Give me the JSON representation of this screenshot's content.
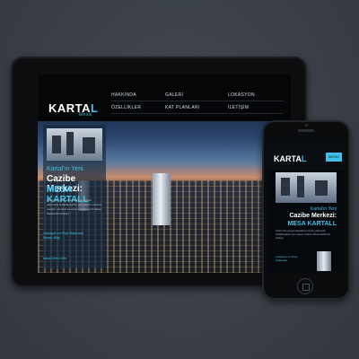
{
  "tablet": {
    "logo": {
      "text": "KARTAL",
      "accent": "L",
      "sub": "Mesa"
    },
    "nav": [
      "HAKKINDA",
      "GALERİ",
      "LOKASYON",
      "ÖZELLİKLER",
      "KAT PLANLARI",
      "İLETİŞİM"
    ],
    "headline_small": "Kartal'ın Yeni",
    "headline_mid": "Cazibe Merkezi:",
    "headline_big": "MESA KARTALL",
    "body": "Şehrin tüm sosyal olanaklarını hemen yakınında bulabileceğiniz yeni yaşam merkezi; modern mimarisi ve eşsiz manzarası ile Mesa Kartall sizi bekliyor.",
    "footer_link": "Lokasyon ve Proje Hakkında Detaylı Bilgi",
    "footer_link2": "Kartal Mesa Ofis"
  },
  "phone": {
    "logo": {
      "text": "KARTAL",
      "accent": "L"
    },
    "menu_label": "MENÜ",
    "headline_small": "Kartal'ın Yeni",
    "headline_mid": "Cazibe Merkezi:",
    "headline_big": "MESA KARTALL",
    "body": "Şehrin tüm sosyal olanaklarını hemen yakınında bulabileceğiniz yeni yaşam merkezi; Mesa Kartall sizi bekliyor.",
    "footer_link": "Lokasyon ve Proje Hakkında"
  },
  "colors": {
    "accent": "#3ec0e8",
    "background": "#3a3f47",
    "device": "#0d0e10"
  }
}
